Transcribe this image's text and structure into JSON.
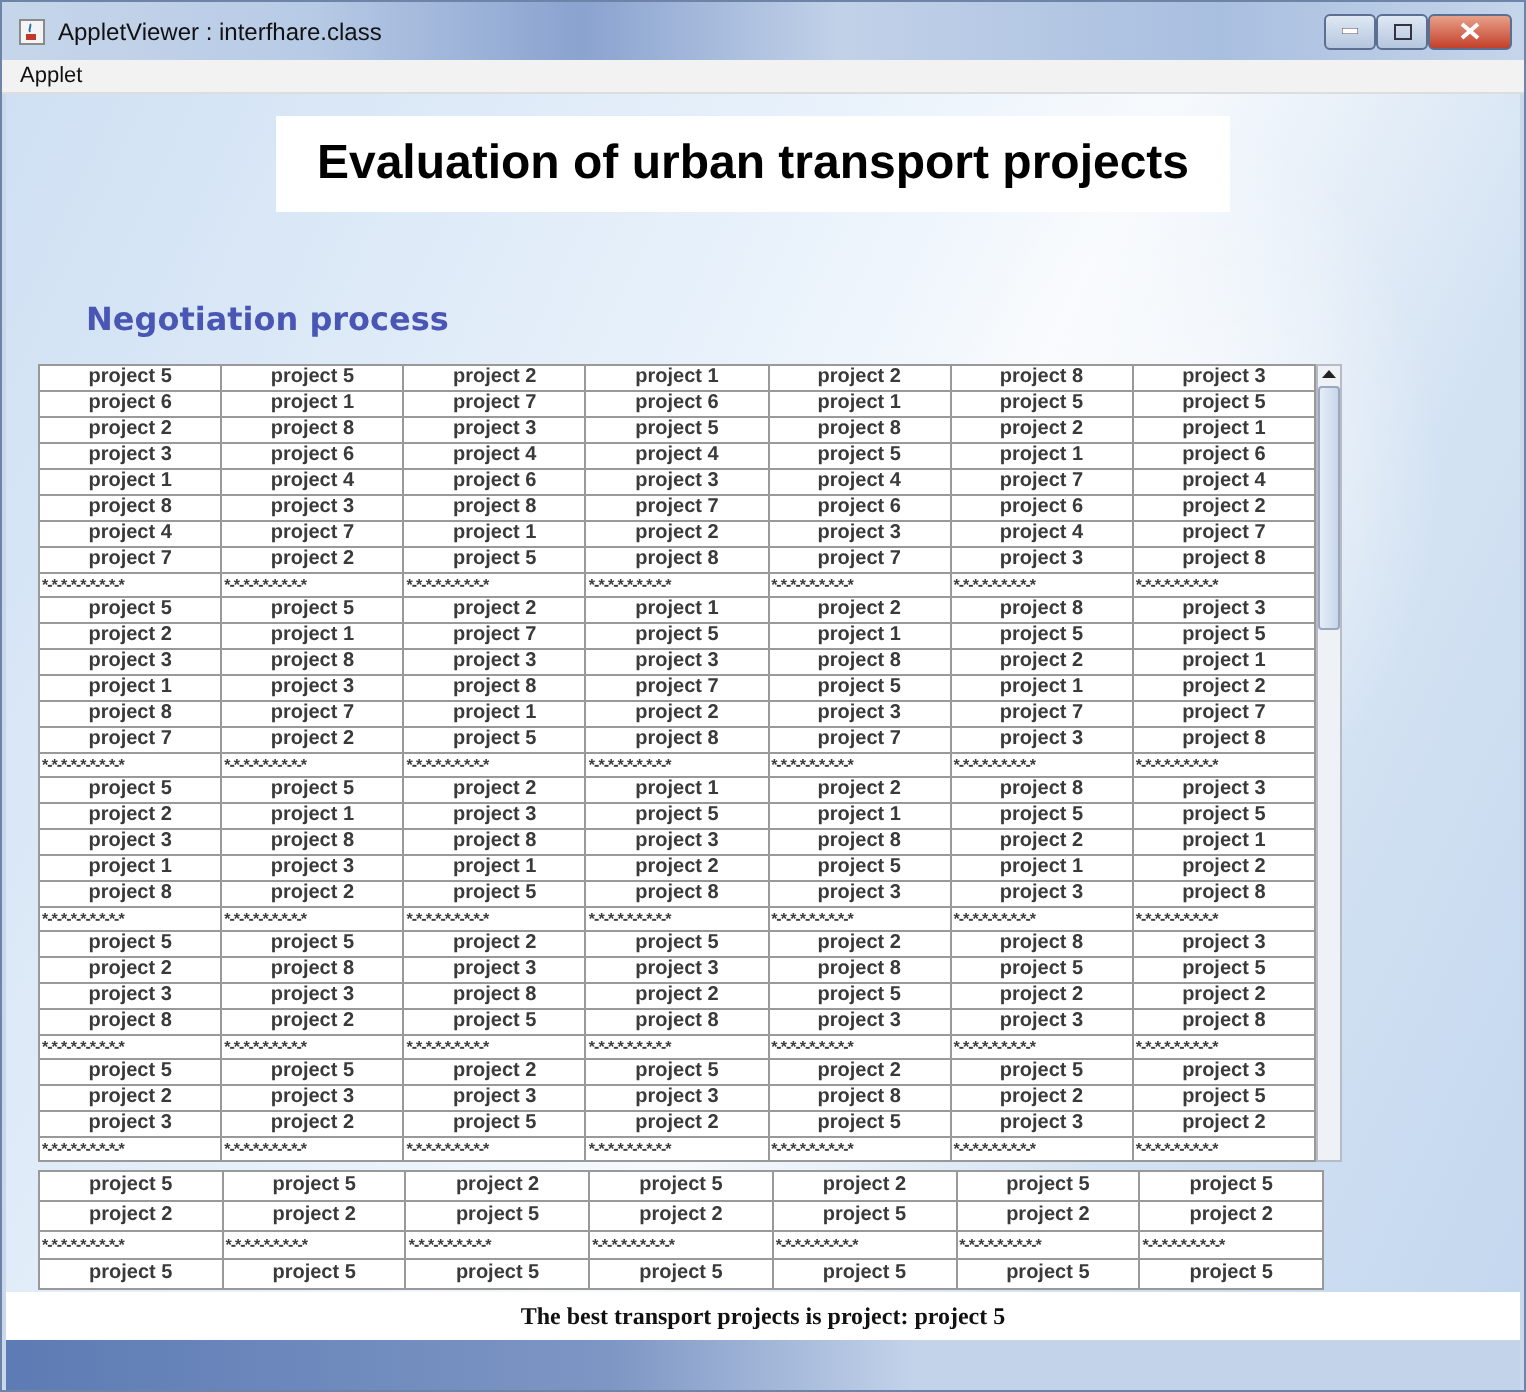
{
  "window": {
    "title": "AppletViewer : interfhare.class"
  },
  "menu": [
    "Applet"
  ],
  "heading": "Evaluation of urban transport projects",
  "section_title": "Negotiation process",
  "main_table": {
    "rows": [
      {
        "kind": "data",
        "cells": [
          "project 5",
          "project 5",
          "project 2",
          "project 1",
          "project 2",
          "project 8",
          "project 3"
        ]
      },
      {
        "kind": "data",
        "cells": [
          "project 6",
          "project 1",
          "project 7",
          "project 6",
          "project 1",
          "project 5",
          "project 5"
        ]
      },
      {
        "kind": "data",
        "cells": [
          "project 2",
          "project 8",
          "project 3",
          "project 5",
          "project 8",
          "project 2",
          "project 1"
        ]
      },
      {
        "kind": "data",
        "cells": [
          "project 3",
          "project 6",
          "project 4",
          "project 4",
          "project 5",
          "project 1",
          "project 6"
        ]
      },
      {
        "kind": "data",
        "cells": [
          "project 1",
          "project 4",
          "project 6",
          "project 3",
          "project 4",
          "project 7",
          "project 4"
        ]
      },
      {
        "kind": "data",
        "cells": [
          "project 8",
          "project 3",
          "project 8",
          "project 7",
          "project 6",
          "project 6",
          "project 2"
        ]
      },
      {
        "kind": "data",
        "cells": [
          "project 4",
          "project 7",
          "project 1",
          "project 2",
          "project 3",
          "project 4",
          "project 7"
        ]
      },
      {
        "kind": "data",
        "cells": [
          "project 7",
          "project 2",
          "project 5",
          "project 8",
          "project 7",
          "project 3",
          "project 8"
        ]
      },
      {
        "kind": "separator",
        "cells": [
          "*-*-*-*-*-*-*-*-*",
          "*-*-*-*-*-*-*-*-*",
          "*-*-*-*-*-*-*-*-*",
          "*-*-*-*-*-*-*-*-*",
          "*-*-*-*-*-*-*-*-*",
          "*-*-*-*-*-*-*-*-*",
          "*-*-*-*-*-*-*-*-*"
        ]
      },
      {
        "kind": "data",
        "cells": [
          "project 5",
          "project 5",
          "project 2",
          "project 1",
          "project 2",
          "project 8",
          "project 3"
        ]
      },
      {
        "kind": "data",
        "cells": [
          "project 2",
          "project 1",
          "project 7",
          "project 5",
          "project 1",
          "project 5",
          "project 5"
        ]
      },
      {
        "kind": "data",
        "cells": [
          "project 3",
          "project 8",
          "project 3",
          "project 3",
          "project 8",
          "project 2",
          "project 1"
        ]
      },
      {
        "kind": "data",
        "cells": [
          "project 1",
          "project 3",
          "project 8",
          "project 7",
          "project 5",
          "project 1",
          "project 2"
        ]
      },
      {
        "kind": "data",
        "cells": [
          "project 8",
          "project 7",
          "project 1",
          "project 2",
          "project 3",
          "project 7",
          "project 7"
        ]
      },
      {
        "kind": "data",
        "cells": [
          "project 7",
          "project 2",
          "project 5",
          "project 8",
          "project 7",
          "project 3",
          "project 8"
        ]
      },
      {
        "kind": "separator",
        "cells": [
          "*-*-*-*-*-*-*-*-*",
          "*-*-*-*-*-*-*-*-*",
          "*-*-*-*-*-*-*-*-*",
          "*-*-*-*-*-*-*-*-*",
          "*-*-*-*-*-*-*-*-*",
          "*-*-*-*-*-*-*-*-*",
          "*-*-*-*-*-*-*-*-*"
        ]
      },
      {
        "kind": "data",
        "cells": [
          "project 5",
          "project 5",
          "project 2",
          "project 1",
          "project 2",
          "project 8",
          "project 3"
        ]
      },
      {
        "kind": "data",
        "cells": [
          "project 2",
          "project 1",
          "project 3",
          "project 5",
          "project 1",
          "project 5",
          "project 5"
        ]
      },
      {
        "kind": "data",
        "cells": [
          "project 3",
          "project 8",
          "project 8",
          "project 3",
          "project 8",
          "project 2",
          "project 1"
        ]
      },
      {
        "kind": "data",
        "cells": [
          "project 1",
          "project 3",
          "project 1",
          "project 2",
          "project 5",
          "project 1",
          "project 2"
        ]
      },
      {
        "kind": "data",
        "cells": [
          "project 8",
          "project 2",
          "project 5",
          "project 8",
          "project 3",
          "project 3",
          "project 8"
        ]
      },
      {
        "kind": "separator",
        "cells": [
          "*-*-*-*-*-*-*-*-*",
          "*-*-*-*-*-*-*-*-*",
          "*-*-*-*-*-*-*-*-*",
          "*-*-*-*-*-*-*-*-*",
          "*-*-*-*-*-*-*-*-*",
          "*-*-*-*-*-*-*-*-*",
          "*-*-*-*-*-*-*-*-*"
        ]
      },
      {
        "kind": "data",
        "cells": [
          "project 5",
          "project 5",
          "project 2",
          "project 5",
          "project 2",
          "project 8",
          "project 3"
        ]
      },
      {
        "kind": "data",
        "cells": [
          "project 2",
          "project 8",
          "project 3",
          "project 3",
          "project 8",
          "project 5",
          "project 5"
        ]
      },
      {
        "kind": "data",
        "cells": [
          "project 3",
          "project 3",
          "project 8",
          "project 2",
          "project 5",
          "project 2",
          "project 2"
        ]
      },
      {
        "kind": "data",
        "cells": [
          "project 8",
          "project 2",
          "project 5",
          "project 8",
          "project 3",
          "project 3",
          "project 8"
        ]
      },
      {
        "kind": "separator",
        "cells": [
          "*-*-*-*-*-*-*-*-*",
          "*-*-*-*-*-*-*-*-*",
          "*-*-*-*-*-*-*-*-*",
          "*-*-*-*-*-*-*-*-*",
          "*-*-*-*-*-*-*-*-*",
          "*-*-*-*-*-*-*-*-*",
          "*-*-*-*-*-*-*-*-*"
        ]
      },
      {
        "kind": "data",
        "cells": [
          "project 5",
          "project 5",
          "project 2",
          "project 5",
          "project 2",
          "project 5",
          "project 3"
        ]
      },
      {
        "kind": "data",
        "cells": [
          "project 2",
          "project 3",
          "project 3",
          "project 3",
          "project 8",
          "project 2",
          "project 5"
        ]
      },
      {
        "kind": "data",
        "cells": [
          "project 3",
          "project 2",
          "project 5",
          "project 2",
          "project 5",
          "project 3",
          "project 2"
        ]
      },
      {
        "kind": "separator",
        "cells": [
          "*-*-*-*-*-*-*-*-*",
          "*-*-*-*-*-*-*-*-*",
          "*-*-*-*-*-*-*-*-*",
          "*-*-*-*-*-*-*-*-*",
          "*-*-*-*-*-*-*-*-*",
          "*-*-*-*-*-*-*-*-*",
          "*-*-*-*-*-*-*-*-*"
        ]
      }
    ]
  },
  "final_table": {
    "rows": [
      {
        "kind": "data",
        "cells": [
          "project 5",
          "project 5",
          "project 2",
          "project 5",
          "project 2",
          "project 5",
          "project 5"
        ]
      },
      {
        "kind": "data",
        "cells": [
          "project 2",
          "project 2",
          "project 5",
          "project 2",
          "project 5",
          "project 2",
          "project 2"
        ]
      },
      {
        "kind": "separator",
        "cells": [
          "*-*-*-*-*-*-*-*-*",
          "*-*-*-*-*-*-*-*-*",
          "*-*-*-*-*-*-*-*-*",
          "*-*-*-*-*-*-*-*-*",
          "*-*-*-*-*-*-*-*-*",
          "*-*-*-*-*-*-*-*-*",
          "*-*-*-*-*-*-*-*-*"
        ]
      },
      {
        "kind": "data",
        "cells": [
          "project 5",
          "project 5",
          "project 5",
          "project 5",
          "project 5",
          "project 5",
          "project 5"
        ]
      }
    ]
  },
  "result": "The best transport projects is project: project 5"
}
